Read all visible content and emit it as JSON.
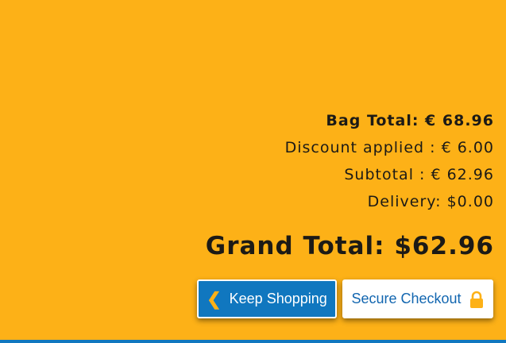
{
  "summary": {
    "bag_total": "Bag Total: € 68.96",
    "discount": "Discount applied : € 6.00",
    "subtotal": "Subtotal : € 62.96",
    "delivery": "Delivery: $0.00",
    "grand_total": "Grand Total: $62.96"
  },
  "actions": {
    "keep_shopping_label": "Keep Shopping",
    "secure_checkout_label": "Secure Checkout",
    "keep_shopping_icon": "chevron-left-icon",
    "secure_checkout_icon": "lock-icon"
  },
  "colors": {
    "background": "#fdb117",
    "primary_blue": "#1077bf",
    "text_dark": "#1c1a16",
    "accent": "#fdb117"
  }
}
